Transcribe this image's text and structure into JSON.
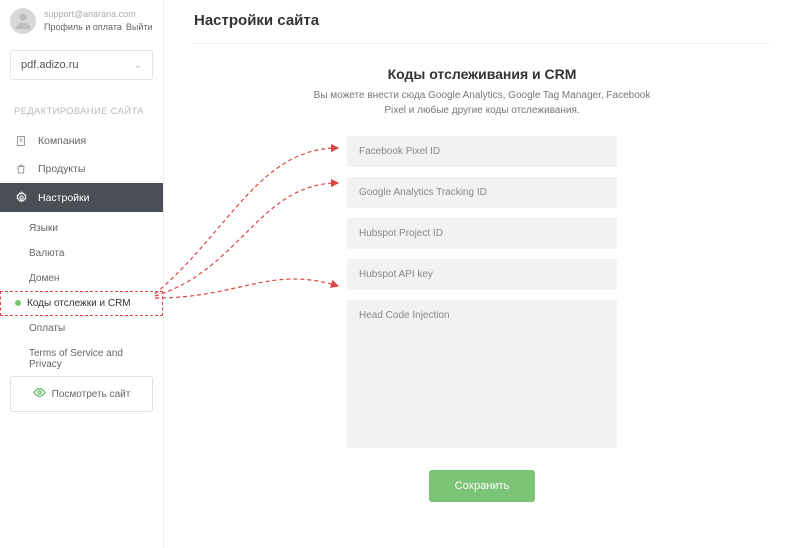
{
  "user": {
    "email": "support@anarana.com",
    "profile_link": "Профиль и оплата",
    "logout_link": "Выйти"
  },
  "site_select": {
    "value": "pdf.adizo.ru"
  },
  "section_title": "РЕДАКТИРОВАНИЕ САЙТА",
  "nav": {
    "company": "Компания",
    "products": "Продукты",
    "settings": "Настройки"
  },
  "subnav": {
    "languages": "Языки",
    "currency": "Валюта",
    "domain": "Домен",
    "tracking": "Коды отслежки и CRM",
    "payments": "Оплаты",
    "tos": "Terms of Service and Privacy"
  },
  "view_site": "Посмотреть сайт",
  "page": {
    "title": "Настройки сайта",
    "form_title": "Коды отслеживания и CRM",
    "form_desc": "Вы можете внести сюда Google Analytics, Google Tag Manager, Facebook Pixel и любые другие коды отслеживания.",
    "fb_pixel_ph": "Facebook Pixel ID",
    "ga_ph": "Google Analytics Tracking ID",
    "hubspot_project_ph": "Hubspot Project ID",
    "hubspot_api_ph": "Hubspot API key",
    "head_code_ph": "Head Code Injection",
    "save": "Сохранить"
  }
}
